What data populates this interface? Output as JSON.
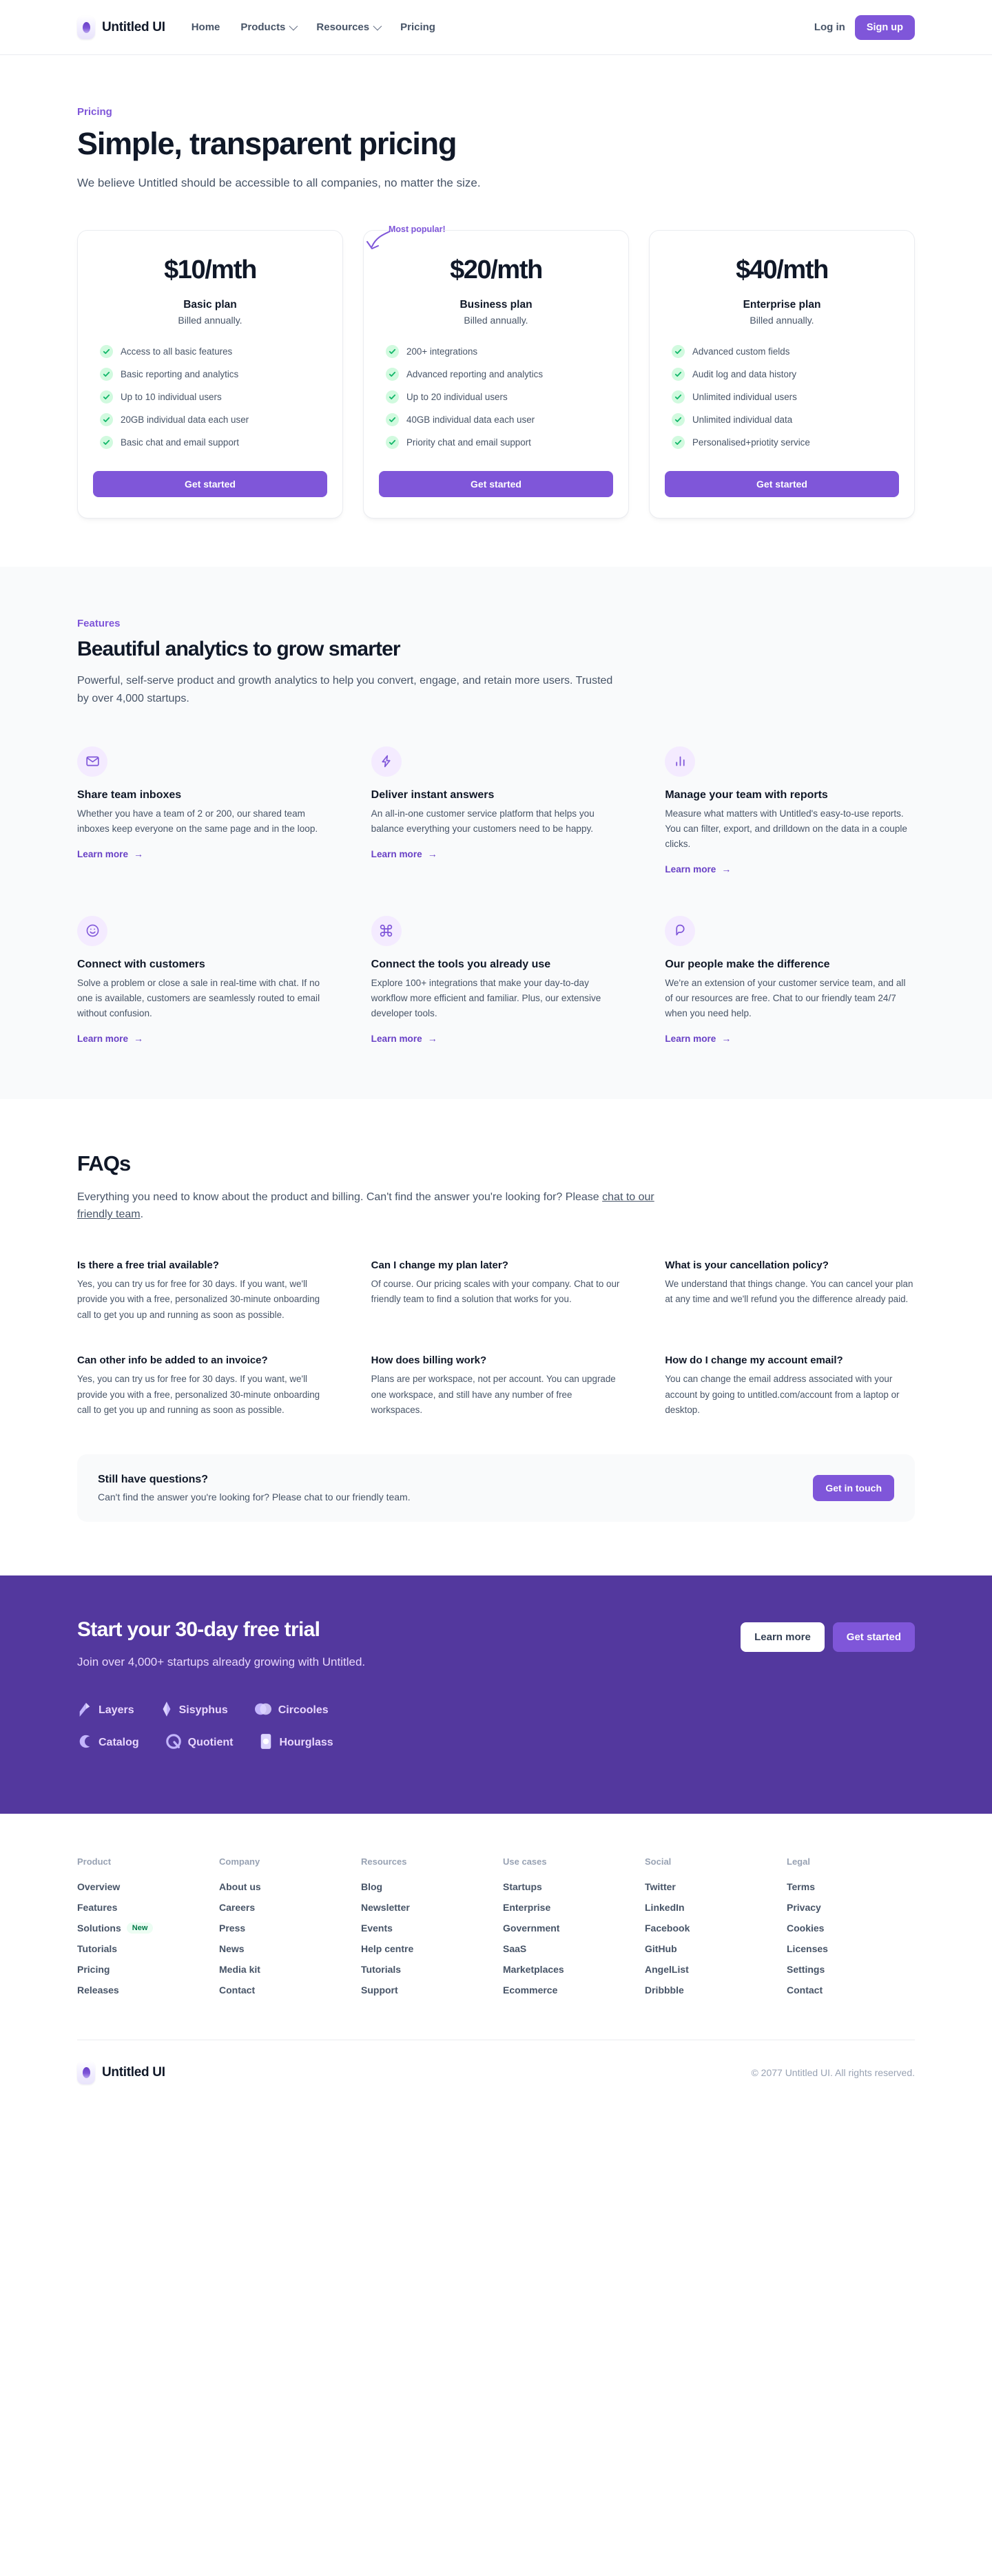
{
  "header": {
    "brand": "Untitled UI",
    "nav": [
      {
        "label": "Home",
        "dropdown": false
      },
      {
        "label": "Products",
        "dropdown": true
      },
      {
        "label": "Resources",
        "dropdown": true
      },
      {
        "label": "Pricing",
        "dropdown": false
      }
    ],
    "login_label": "Log in",
    "signup_label": "Sign up"
  },
  "hero": {
    "eyebrow": "Pricing",
    "title": "Simple, transparent pricing",
    "subtitle": "We believe Untitled should be accessible to all companies, no matter the size."
  },
  "pricing": {
    "popular_badge": "Most popular!",
    "plans": [
      {
        "price": "$10/mth",
        "name": "Basic plan",
        "billed": "Billed annually.",
        "cta": "Get started",
        "features": [
          "Access to all basic features",
          "Basic reporting and analytics",
          "Up to 10 individual users",
          "20GB individual data each user",
          "Basic chat and email support"
        ]
      },
      {
        "price": "$20/mth",
        "name": "Business plan",
        "billed": "Billed annually.",
        "cta": "Get started",
        "features": [
          "200+ integrations",
          "Advanced reporting and analytics",
          "Up to 20 individual users",
          "40GB individual data each user",
          "Priority chat and email support"
        ]
      },
      {
        "price": "$40/mth",
        "name": "Enterprise plan",
        "billed": "Billed annually.",
        "cta": "Get started",
        "features": [
          "Advanced custom fields",
          "Audit log and data history",
          "Unlimited individual users",
          "Unlimited individual data",
          "Personalised+priotity service"
        ]
      }
    ]
  },
  "features": {
    "eyebrow": "Features",
    "title": "Beautiful analytics to grow smarter",
    "subtitle": "Powerful, self-serve product and growth analytics to help you convert, engage, and retain more users. Trusted by over 4,000 startups.",
    "learn_more": "Learn more",
    "items": [
      {
        "icon": "mail-icon",
        "title": "Share team inboxes",
        "desc": "Whether you have a team of 2 or 200, our shared team inboxes keep everyone on the same page and in the loop."
      },
      {
        "icon": "lightning-icon",
        "title": "Deliver instant answers",
        "desc": "An all-in-one customer service platform that helps you balance everything your customers need to be happy."
      },
      {
        "icon": "bar-chart-icon",
        "title": "Manage your team with reports",
        "desc": "Measure what matters with Untitled's easy-to-use reports. You can filter, export, and drilldown on the data in a couple clicks."
      },
      {
        "icon": "smiley-icon",
        "title": "Connect with customers",
        "desc": "Solve a problem or close a sale in real-time with chat. If no one is available, customers are seamlessly routed to email without confusion."
      },
      {
        "icon": "command-icon",
        "title": "Connect the tools you already use",
        "desc": "Explore 100+ integrations that make your day-to-day workflow more efficient and familiar. Plus, our extensive developer tools."
      },
      {
        "icon": "chat-bubble-icon",
        "title": "Our people make the difference",
        "desc": "We're an extension of your customer service team, and all of our resources are free. Chat to our friendly team 24/7 when you need help."
      }
    ]
  },
  "faq": {
    "title": "FAQs",
    "subtitle_before": "Everything you need to know about the product and billing. Can't find the answer you're looking for? Please ",
    "subtitle_link": "chat to our friendly team",
    "subtitle_after": ".",
    "items": [
      {
        "q": "Is there a free trial available?",
        "a": "Yes, you can try us for free for 30 days. If you want, we'll provide you with a free, personalized 30-minute onboarding call to get you up and running as soon as possible."
      },
      {
        "q": "Can I change my plan later?",
        "a": "Of course. Our pricing scales with your company. Chat to our friendly team to find a solution that works for you."
      },
      {
        "q": "What is your cancellation policy?",
        "a": "We understand that things change. You can cancel your plan at any time and we'll refund you the difference already paid."
      },
      {
        "q": "Can other info be added to an invoice?",
        "a": "Yes, you can try us for free for 30 days. If you want, we'll provide you with a free, personalized 30-minute onboarding call to get you up and running as soon as possible."
      },
      {
        "q": "How does billing work?",
        "a": "Plans are per workspace, not per account. You can upgrade one workspace, and still have any number of free workspaces."
      },
      {
        "q": "How do I change my account email?",
        "a": "You can change the email address associated with your account by going to untitled.com/account from a laptop or desktop."
      }
    ],
    "still": {
      "title": "Still have questions?",
      "desc": "Can't find the answer you're looking for? Please chat to our friendly team.",
      "cta": "Get in touch"
    }
  },
  "cta": {
    "title": "Start your 30-day free trial",
    "subtitle": "Join over 4,000+ startups already growing with Untitled.",
    "learn_more": "Learn more",
    "get_started": "Get started",
    "logos": [
      {
        "name": "Layers",
        "icon": "layers-logo"
      },
      {
        "name": "Sisyphus",
        "icon": "sisyphus-logo"
      },
      {
        "name": "Circooles",
        "icon": "circooles-logo"
      },
      {
        "name": "Catalog",
        "icon": "catalog-logo"
      },
      {
        "name": "Quotient",
        "icon": "quotient-logo"
      },
      {
        "name": "Hourglass",
        "icon": "hourglass-logo"
      }
    ]
  },
  "footer": {
    "columns": [
      {
        "head": "Product",
        "links": [
          {
            "label": "Overview"
          },
          {
            "label": "Features"
          },
          {
            "label": "Solutions",
            "badge": "New"
          },
          {
            "label": "Tutorials"
          },
          {
            "label": "Pricing"
          },
          {
            "label": "Releases"
          }
        ]
      },
      {
        "head": "Company",
        "links": [
          {
            "label": "About us"
          },
          {
            "label": "Careers"
          },
          {
            "label": "Press"
          },
          {
            "label": "News"
          },
          {
            "label": "Media kit"
          },
          {
            "label": "Contact"
          }
        ]
      },
      {
        "head": "Resources",
        "links": [
          {
            "label": "Blog"
          },
          {
            "label": "Newsletter"
          },
          {
            "label": "Events"
          },
          {
            "label": "Help centre"
          },
          {
            "label": "Tutorials"
          },
          {
            "label": "Support"
          }
        ]
      },
      {
        "head": "Use cases",
        "links": [
          {
            "label": "Startups"
          },
          {
            "label": "Enterprise"
          },
          {
            "label": "Government"
          },
          {
            "label": "SaaS"
          },
          {
            "label": "Marketplaces"
          },
          {
            "label": "Ecommerce"
          }
        ]
      },
      {
        "head": "Social",
        "links": [
          {
            "label": "Twitter"
          },
          {
            "label": "LinkedIn"
          },
          {
            "label": "Facebook"
          },
          {
            "label": "GitHub"
          },
          {
            "label": "AngelList"
          },
          {
            "label": "Dribbble"
          }
        ]
      },
      {
        "head": "Legal",
        "links": [
          {
            "label": "Terms"
          },
          {
            "label": "Privacy"
          },
          {
            "label": "Cookies"
          },
          {
            "label": "Licenses"
          },
          {
            "label": "Settings"
          },
          {
            "label": "Contact"
          }
        ]
      }
    ],
    "brand": "Untitled UI",
    "copyright": "© 2077 Untitled UI. All rights reserved."
  },
  "colors": {
    "primary": "#7f56d9",
    "primary_dark": "#53389e",
    "primary_text": "#6941c6",
    "text": "#101828",
    "muted": "#475467",
    "success": "#12b76a",
    "success_bg": "#d1fadf"
  }
}
